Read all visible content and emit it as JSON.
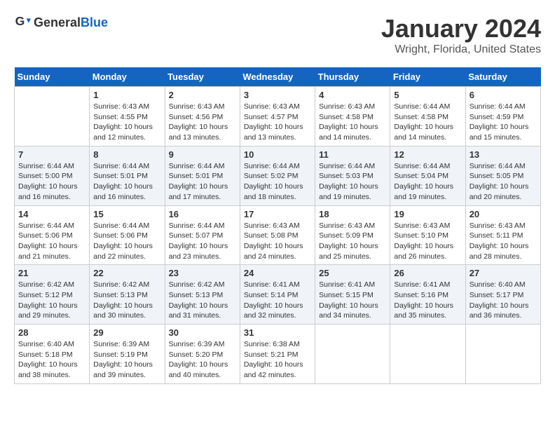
{
  "header": {
    "logo_general": "General",
    "logo_blue": "Blue",
    "title": "January 2024",
    "subtitle": "Wright, Florida, United States"
  },
  "calendar": {
    "days_of_week": [
      "Sunday",
      "Monday",
      "Tuesday",
      "Wednesday",
      "Thursday",
      "Friday",
      "Saturday"
    ],
    "weeks": [
      [
        {
          "day": "",
          "sunrise": "",
          "sunset": "",
          "daylight": ""
        },
        {
          "day": "1",
          "sunrise": "Sunrise: 6:43 AM",
          "sunset": "Sunset: 4:55 PM",
          "daylight": "Daylight: 10 hours and 12 minutes."
        },
        {
          "day": "2",
          "sunrise": "Sunrise: 6:43 AM",
          "sunset": "Sunset: 4:56 PM",
          "daylight": "Daylight: 10 hours and 13 minutes."
        },
        {
          "day": "3",
          "sunrise": "Sunrise: 6:43 AM",
          "sunset": "Sunset: 4:57 PM",
          "daylight": "Daylight: 10 hours and 13 minutes."
        },
        {
          "day": "4",
          "sunrise": "Sunrise: 6:43 AM",
          "sunset": "Sunset: 4:58 PM",
          "daylight": "Daylight: 10 hours and 14 minutes."
        },
        {
          "day": "5",
          "sunrise": "Sunrise: 6:44 AM",
          "sunset": "Sunset: 4:58 PM",
          "daylight": "Daylight: 10 hours and 14 minutes."
        },
        {
          "day": "6",
          "sunrise": "Sunrise: 6:44 AM",
          "sunset": "Sunset: 4:59 PM",
          "daylight": "Daylight: 10 hours and 15 minutes."
        }
      ],
      [
        {
          "day": "7",
          "sunrise": "Sunrise: 6:44 AM",
          "sunset": "Sunset: 5:00 PM",
          "daylight": "Daylight: 10 hours and 16 minutes."
        },
        {
          "day": "8",
          "sunrise": "Sunrise: 6:44 AM",
          "sunset": "Sunset: 5:01 PM",
          "daylight": "Daylight: 10 hours and 16 minutes."
        },
        {
          "day": "9",
          "sunrise": "Sunrise: 6:44 AM",
          "sunset": "Sunset: 5:01 PM",
          "daylight": "Daylight: 10 hours and 17 minutes."
        },
        {
          "day": "10",
          "sunrise": "Sunrise: 6:44 AM",
          "sunset": "Sunset: 5:02 PM",
          "daylight": "Daylight: 10 hours and 18 minutes."
        },
        {
          "day": "11",
          "sunrise": "Sunrise: 6:44 AM",
          "sunset": "Sunset: 5:03 PM",
          "daylight": "Daylight: 10 hours and 19 minutes."
        },
        {
          "day": "12",
          "sunrise": "Sunrise: 6:44 AM",
          "sunset": "Sunset: 5:04 PM",
          "daylight": "Daylight: 10 hours and 19 minutes."
        },
        {
          "day": "13",
          "sunrise": "Sunrise: 6:44 AM",
          "sunset": "Sunset: 5:05 PM",
          "daylight": "Daylight: 10 hours and 20 minutes."
        }
      ],
      [
        {
          "day": "14",
          "sunrise": "Sunrise: 6:44 AM",
          "sunset": "Sunset: 5:06 PM",
          "daylight": "Daylight: 10 hours and 21 minutes."
        },
        {
          "day": "15",
          "sunrise": "Sunrise: 6:44 AM",
          "sunset": "Sunset: 5:06 PM",
          "daylight": "Daylight: 10 hours and 22 minutes."
        },
        {
          "day": "16",
          "sunrise": "Sunrise: 6:44 AM",
          "sunset": "Sunset: 5:07 PM",
          "daylight": "Daylight: 10 hours and 23 minutes."
        },
        {
          "day": "17",
          "sunrise": "Sunrise: 6:43 AM",
          "sunset": "Sunset: 5:08 PM",
          "daylight": "Daylight: 10 hours and 24 minutes."
        },
        {
          "day": "18",
          "sunrise": "Sunrise: 6:43 AM",
          "sunset": "Sunset: 5:09 PM",
          "daylight": "Daylight: 10 hours and 25 minutes."
        },
        {
          "day": "19",
          "sunrise": "Sunrise: 6:43 AM",
          "sunset": "Sunset: 5:10 PM",
          "daylight": "Daylight: 10 hours and 26 minutes."
        },
        {
          "day": "20",
          "sunrise": "Sunrise: 6:43 AM",
          "sunset": "Sunset: 5:11 PM",
          "daylight": "Daylight: 10 hours and 28 minutes."
        }
      ],
      [
        {
          "day": "21",
          "sunrise": "Sunrise: 6:42 AM",
          "sunset": "Sunset: 5:12 PM",
          "daylight": "Daylight: 10 hours and 29 minutes."
        },
        {
          "day": "22",
          "sunrise": "Sunrise: 6:42 AM",
          "sunset": "Sunset: 5:13 PM",
          "daylight": "Daylight: 10 hours and 30 minutes."
        },
        {
          "day": "23",
          "sunrise": "Sunrise: 6:42 AM",
          "sunset": "Sunset: 5:13 PM",
          "daylight": "Daylight: 10 hours and 31 minutes."
        },
        {
          "day": "24",
          "sunrise": "Sunrise: 6:41 AM",
          "sunset": "Sunset: 5:14 PM",
          "daylight": "Daylight: 10 hours and 32 minutes."
        },
        {
          "day": "25",
          "sunrise": "Sunrise: 6:41 AM",
          "sunset": "Sunset: 5:15 PM",
          "daylight": "Daylight: 10 hours and 34 minutes."
        },
        {
          "day": "26",
          "sunrise": "Sunrise: 6:41 AM",
          "sunset": "Sunset: 5:16 PM",
          "daylight": "Daylight: 10 hours and 35 minutes."
        },
        {
          "day": "27",
          "sunrise": "Sunrise: 6:40 AM",
          "sunset": "Sunset: 5:17 PM",
          "daylight": "Daylight: 10 hours and 36 minutes."
        }
      ],
      [
        {
          "day": "28",
          "sunrise": "Sunrise: 6:40 AM",
          "sunset": "Sunset: 5:18 PM",
          "daylight": "Daylight: 10 hours and 38 minutes."
        },
        {
          "day": "29",
          "sunrise": "Sunrise: 6:39 AM",
          "sunset": "Sunset: 5:19 PM",
          "daylight": "Daylight: 10 hours and 39 minutes."
        },
        {
          "day": "30",
          "sunrise": "Sunrise: 6:39 AM",
          "sunset": "Sunset: 5:20 PM",
          "daylight": "Daylight: 10 hours and 40 minutes."
        },
        {
          "day": "31",
          "sunrise": "Sunrise: 6:38 AM",
          "sunset": "Sunset: 5:21 PM",
          "daylight": "Daylight: 10 hours and 42 minutes."
        },
        {
          "day": "",
          "sunrise": "",
          "sunset": "",
          "daylight": ""
        },
        {
          "day": "",
          "sunrise": "",
          "sunset": "",
          "daylight": ""
        },
        {
          "day": "",
          "sunrise": "",
          "sunset": "",
          "daylight": ""
        }
      ]
    ]
  }
}
